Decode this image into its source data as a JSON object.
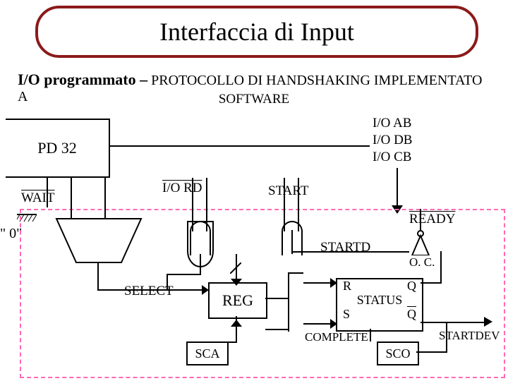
{
  "title": "Interfaccia di Input",
  "subtitle_bold": "I/O programmato –",
  "subtitle_rest": " PROTOCOLLO DI HANDSHAKING IMPLEMENTATO A",
  "subtitle2": "SOFTWARE",
  "pd32": "PD 32",
  "io_rd": "I/O RD",
  "start": "START",
  "io_ab": "I/O AB",
  "io_db": "I/O DB",
  "io_cb": "I/O CB",
  "wait": "WAIT",
  "zero": "\" 0\"",
  "ready": "READY",
  "startd": "STARTD",
  "oc": "O. C.",
  "select": "SELECT",
  "reg": "REG",
  "r": "R",
  "q": "Q",
  "status": "STATUS",
  "s": "S",
  "qbar": "Q",
  "complete": "COMPLETE",
  "startdev": "STARTDEV",
  "sca": "SCA",
  "sco": "SCO"
}
